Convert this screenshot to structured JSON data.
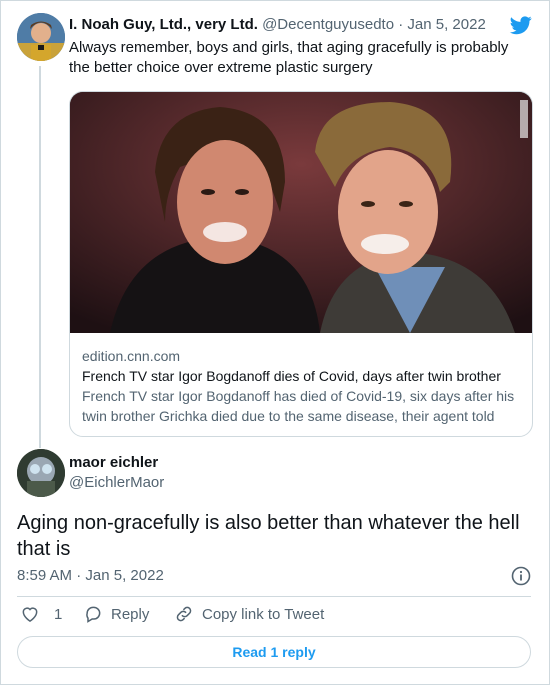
{
  "colors": {
    "accent": "#1d9bf0",
    "muted": "#536471",
    "text": "#0f1419",
    "border": "#cfd9de"
  },
  "quoted_tweet": {
    "author_name": "I. Noah Guy, Ltd., very Ltd.",
    "author_handle": "@Decentguyusedto",
    "separator": "·",
    "date": "Jan 5, 2022",
    "text": "Always remember, boys and girls, that aging gracefully is probably the better choice over extreme plastic surgery",
    "brand_icon": "twitter-bird-icon",
    "link_card": {
      "domain": "edition.cnn.com",
      "title": "French TV star Igor Bogdanoff dies of Covid, days after twin brother",
      "description": "French TV star Igor Bogdanoff has died of Covid-19, six days after his twin brother Grichka died due to the same disease, their agent told CNN"
    }
  },
  "reply_tweet": {
    "author_name": "maor eichler",
    "author_handle": "@EichlerMaor",
    "text": "Aging non-gracefully is also better than whatever the hell that is",
    "time": "8:59 AM",
    "separator": "·",
    "date": "Jan 5, 2022",
    "info_icon": "info-icon"
  },
  "actions": {
    "like_count": "1",
    "reply_label": "Reply",
    "copy_label": "Copy link to Tweet",
    "read_replies_label": "Read 1 reply"
  }
}
